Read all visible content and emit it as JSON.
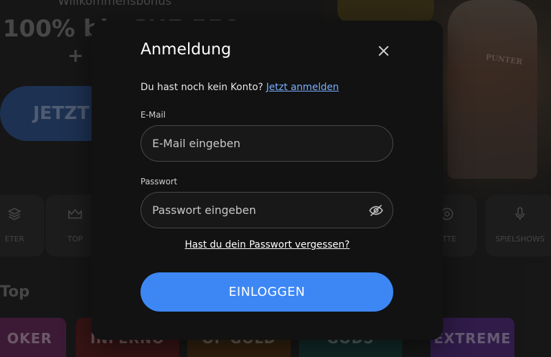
{
  "background": {
    "bonus_title": "Willkommensbonus",
    "bonus_amount": "100% bis",
    "bonus_amount_rest": "CHF 550",
    "bonus_plus": "+ 2",
    "cta_label": "JETZT",
    "figure_label": "PUNTER",
    "categories": [
      {
        "label": "ETER",
        "icon": "layers-icon"
      },
      {
        "label": "TOP",
        "icon": "crown-icon"
      },
      {
        "label": "ETTE",
        "icon": "roulette-icon"
      },
      {
        "label": "SPIELSHOWS",
        "icon": "microphone-icon"
      }
    ],
    "section_title": "Top",
    "tiles": [
      {
        "label": "OKER",
        "color": "#7a2f6b"
      },
      {
        "label": "INFERNO",
        "color": "#6b2424"
      },
      {
        "label": "OF GOLD",
        "color": "#5a3a1a"
      },
      {
        "label": "GODS",
        "color": "#1f4f4a"
      },
      {
        "label": "EXTREME",
        "color": "#5b2f8a"
      }
    ]
  },
  "modal": {
    "title": "Anmeldung",
    "close_icon": "close-icon",
    "signup_prompt": "Du hast noch kein Konto?",
    "signup_link": "Jetzt anmelden",
    "email": {
      "label": "E-Mail",
      "placeholder": "E-Mail eingeben",
      "value": ""
    },
    "password": {
      "label": "Passwort",
      "placeholder": "Passwort eingeben",
      "value": "",
      "toggle_icon": "eye-off-icon"
    },
    "forgot_link": "Hast du dein Passwort vergessen?",
    "login_button": "EINLOGGEN"
  },
  "colors": {
    "accent": "#3d87f5",
    "link": "#7ab0ff",
    "modal_bg": "#121212"
  }
}
